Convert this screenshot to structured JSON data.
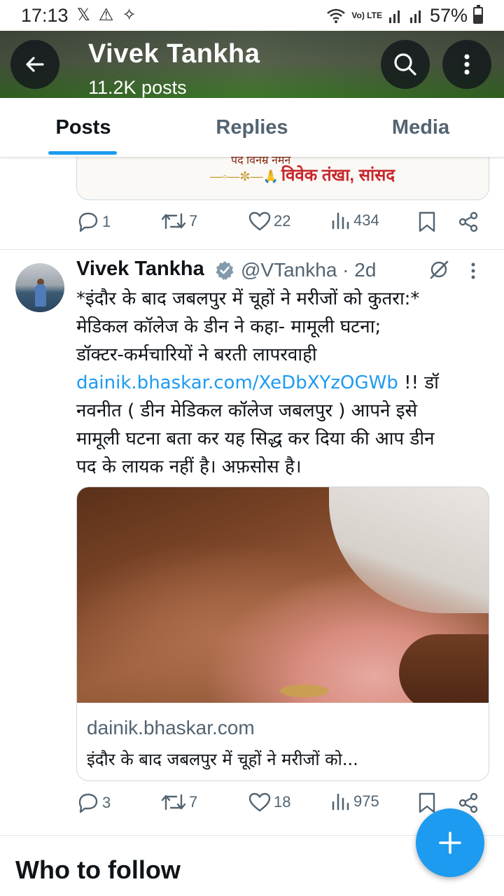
{
  "status_bar": {
    "time": "17:13",
    "network_label": "Vo) LTE",
    "battery": "57%",
    "battery_level": 0.57
  },
  "header": {
    "title": "Vivek Tankha",
    "subtitle": "11.2K posts"
  },
  "tabs": [
    {
      "label": "Posts",
      "active": true
    },
    {
      "label": "Replies",
      "active": false
    },
    {
      "label": "Media",
      "active": false
    }
  ],
  "previous_post": {
    "banner_top": "पद विनम्र नमन",
    "banner_signature": "विवेक तंखा, सांसद",
    "stats": {
      "replies": "1",
      "reposts": "7",
      "likes": "22",
      "views": "434"
    }
  },
  "post": {
    "author_name": "Vivek Tankha",
    "handle": "@VTankha · 2d",
    "text_lines": [
      "*इंदौर के बाद जबलपुर में चूहों ने मरीजों को कुतरा:*",
      "मेडिकल कॉलेज के डीन ने कहा- मामूली घटना;",
      "डॉक्टर-कर्मचारियों ने बरती लापरवाही"
    ],
    "link_text": "dainik.bhaskar.com/XeDbXYzOGWb",
    "after_link": " !! डॉ",
    "text_lines_2": [
      "नवनीत ( डीन मेडिकल कॉलेज जबलपुर ) आपने इसे",
      "मामूली घटना बता कर यह सिद्ध कर दिया की आप डीन",
      "पद के लायक नहीं है। अफ़सोस है।"
    ],
    "card": {
      "domain": "dainik.bhaskar.com",
      "title": "इंदौर के बाद जबलपुर में चूहों ने मरीजों को..."
    },
    "stats": {
      "replies": "3",
      "reposts": "7",
      "likes": "18",
      "views": "975"
    }
  },
  "section": {
    "title": "Who to follow"
  },
  "colors": {
    "accent": "#1d9bf0",
    "text": "#0f1419",
    "muted": "#536471"
  },
  "icons": [
    "back-arrow-icon",
    "search-icon",
    "more-vertical-icon",
    "reply-icon",
    "repost-icon",
    "like-icon",
    "views-icon",
    "bookmark-icon",
    "share-icon",
    "verified-icon",
    "grok-icon",
    "more-horizontal-icon",
    "compose-plus-icon"
  ]
}
